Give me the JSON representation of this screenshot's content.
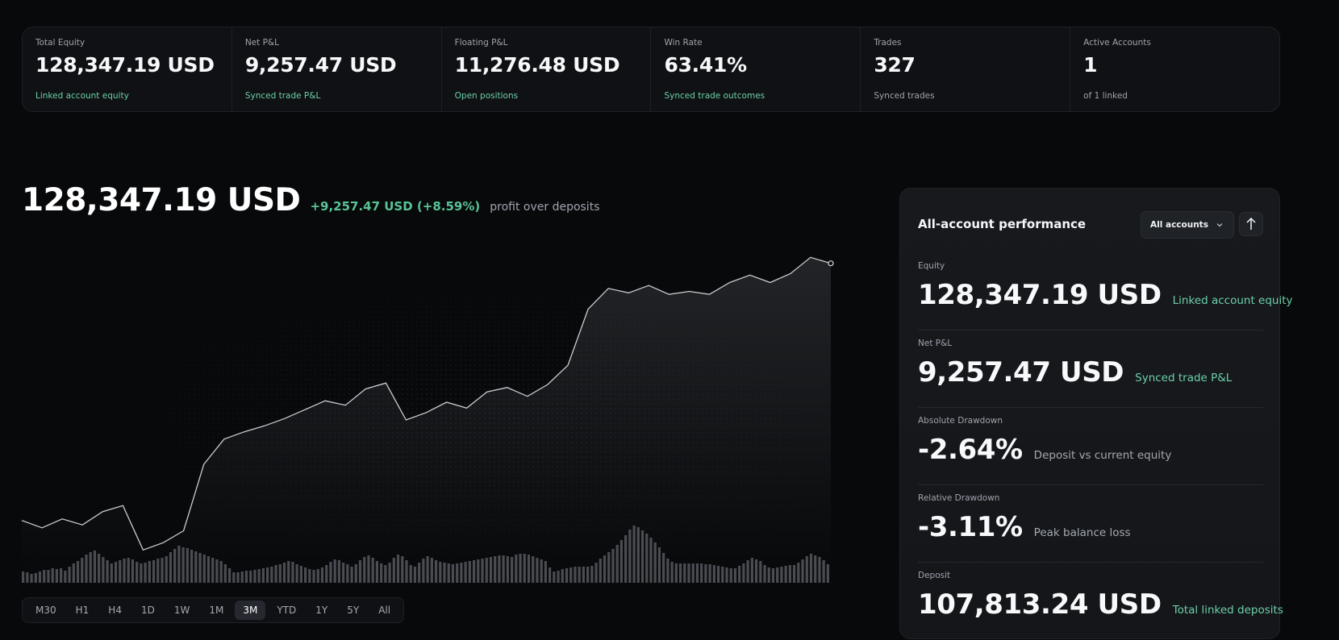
{
  "stats": [
    {
      "label": "Total Equity",
      "value": "128,347.19 USD",
      "sub": "Linked account equity",
      "sub_color": "green"
    },
    {
      "label": "Net P&L",
      "value": "9,257.47 USD",
      "sub": "Synced trade P&L",
      "sub_color": "green"
    },
    {
      "label": "Floating P&L",
      "value": "11,276.48 USD",
      "sub": "Open positions",
      "sub_color": "green"
    },
    {
      "label": "Win Rate",
      "value": "63.41%",
      "sub": "Synced trade outcomes",
      "sub_color": "green"
    },
    {
      "label": "Trades",
      "value": "327",
      "sub": "Synced trades",
      "sub_color": "gray"
    },
    {
      "label": "Active Accounts",
      "value": "1",
      "sub": "of 1 linked",
      "sub_color": "gray"
    }
  ],
  "hero": {
    "value": "128,347.19 USD",
    "change": "+9,257.47 USD (+8.59%)",
    "note": "profit over deposits"
  },
  "ranges": [
    "M30",
    "H1",
    "H4",
    "1D",
    "1W",
    "1M",
    "3M",
    "YTD",
    "1Y",
    "5Y",
    "All"
  ],
  "active_range": "3M",
  "panel": {
    "title": "All-account performance",
    "select_value": "All accounts",
    "metrics": [
      {
        "label": "Equity",
        "value": "128,347.19 USD",
        "sub": "Linked account equity",
        "sub_color": "green"
      },
      {
        "label": "Net P&L",
        "value": "9,257.47 USD",
        "sub": "Synced trade P&L",
        "sub_color": "green"
      },
      {
        "label": "Absolute Drawdown",
        "value": "-2.64%",
        "sub": "Deposit vs current equity",
        "sub_color": "gray"
      },
      {
        "label": "Relative Drawdown",
        "value": "-3.11%",
        "sub": "Peak balance loss",
        "sub_color": "gray"
      },
      {
        "label": "Deposit",
        "value": "107,813.24 USD",
        "sub": "Total linked deposits",
        "sub_color": "green"
      }
    ]
  },
  "colors": {
    "accent_green": "#59c396",
    "line": "#c9ccd1",
    "volume_bar": "#4a4c51",
    "background": "#08090b"
  },
  "chart_data": {
    "type": "line",
    "series": [
      {
        "values": [
          119.6,
          119.1,
          119.7,
          119.3,
          120.2,
          120.6,
          117.6,
          118.1,
          118.9,
          123.4,
          125.1,
          125.6,
          126.0,
          126.5,
          127.1,
          127.7,
          127.4,
          128.5,
          128.9,
          126.4,
          126.9,
          127.6,
          127.2,
          128.3,
          128.6,
          128.0,
          128.8,
          130.1,
          133.9,
          135.3,
          135.0,
          135.5,
          134.9,
          135.1,
          134.9,
          135.7,
          136.2,
          135.7,
          136.3,
          137.4,
          137.0
        ]
      }
    ],
    "volume": [
      14,
      13,
      11,
      12,
      14,
      16,
      16,
      18,
      17,
      18,
      15,
      20,
      24,
      27,
      31,
      35,
      38,
      40,
      36,
      32,
      28,
      24,
      26,
      28,
      30,
      31,
      29,
      26,
      24,
      25,
      27,
      28,
      30,
      31,
      33,
      38,
      42,
      46,
      44,
      43,
      41,
      39,
      37,
      35,
      33,
      31,
      29,
      27,
      23,
      18,
      13,
      13,
      14,
      15,
      15,
      16,
      17,
      18,
      19,
      20,
      22,
      23,
      25,
      27,
      26,
      23,
      21,
      19,
      17,
      16,
      17,
      19,
      22,
      26,
      29,
      28,
      25,
      23,
      20,
      23,
      28,
      32,
      34,
      31,
      27,
      24,
      22,
      25,
      31,
      35,
      33,
      28,
      22,
      20,
      25,
      30,
      33,
      31,
      28,
      26,
      25,
      24,
      23,
      24,
      25,
      26,
      27,
      28,
      29,
      30,
      31,
      32,
      33,
      34,
      34,
      33,
      32,
      35,
      36,
      36,
      35,
      33,
      31,
      29,
      27,
      19,
      14,
      15,
      17,
      18,
      19,
      20,
      20,
      20,
      20,
      21,
      25,
      30,
      34,
      38,
      42,
      47,
      53,
      59,
      66,
      71,
      69,
      65,
      61,
      56,
      50,
      44,
      37,
      30,
      26,
      24,
      24,
      24,
      24,
      24,
      24,
      24,
      23,
      23,
      22,
      21,
      20,
      19,
      18,
      18,
      21,
      24,
      28,
      31,
      29,
      27,
      22,
      19,
      18,
      19,
      20,
      21,
      22,
      22,
      25,
      29,
      33,
      36,
      34,
      32,
      28,
      23
    ],
    "ylim": [
      115,
      139
    ]
  }
}
